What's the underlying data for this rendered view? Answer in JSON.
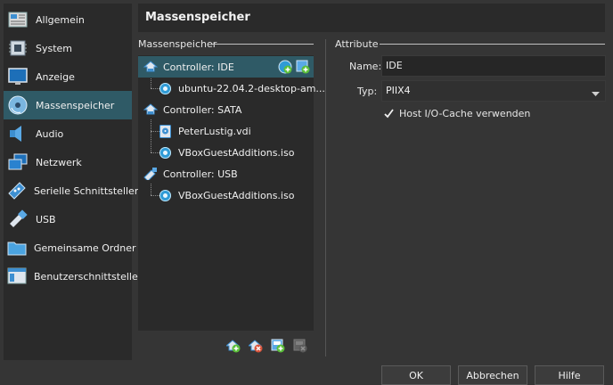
{
  "sidebar": {
    "items": [
      {
        "label": "Allgemein",
        "icon": "general-icon"
      },
      {
        "label": "System",
        "icon": "chip-icon"
      },
      {
        "label": "Anzeige",
        "icon": "monitor-icon"
      },
      {
        "label": "Massenspeicher",
        "icon": "storage-disk-icon",
        "selected": true
      },
      {
        "label": "Audio",
        "icon": "speaker-icon"
      },
      {
        "label": "Netzwerk",
        "icon": "network-icon"
      },
      {
        "label": "Serielle Schnittstellen",
        "icon": "serial-port-icon"
      },
      {
        "label": "USB",
        "icon": "usb-icon"
      },
      {
        "label": "Gemeinsame Ordner",
        "icon": "folder-icon"
      },
      {
        "label": "Benutzerschnittstelle",
        "icon": "window-layout-icon"
      }
    ]
  },
  "header": {
    "title": "Massenspeicher"
  },
  "storage_group": {
    "title": "Massenspeicher"
  },
  "tree": {
    "controllers": [
      {
        "label": "Controller: IDE",
        "selected": true,
        "children": [
          {
            "label": "ubuntu-22.04.2-desktop-am...",
            "kind": "optical"
          }
        ]
      },
      {
        "label": "Controller: SATA",
        "children": [
          {
            "label": "PeterLustig.vdi",
            "kind": "hdd"
          },
          {
            "label": "VBoxGuestAdditions.iso",
            "kind": "optical"
          }
        ]
      },
      {
        "label": "Controller: USB",
        "children": [
          {
            "label": "VBoxGuestAdditions.iso",
            "kind": "optical"
          }
        ]
      }
    ]
  },
  "attributes": {
    "title": "Attribute",
    "name_label": "Name:",
    "name_value": "IDE",
    "type_label": "Typ:",
    "type_value": "PIIX4",
    "cache_label": "Host I/O-Cache verwenden",
    "cache_checked": true
  },
  "buttons": {
    "ok": "OK",
    "cancel": "Abbrechen",
    "help": "Hilfe"
  },
  "colors": {
    "selection": "#2f5a66",
    "panel": "#2a2a2a",
    "background": "#353535",
    "accent_green": "#5bbf3a"
  }
}
